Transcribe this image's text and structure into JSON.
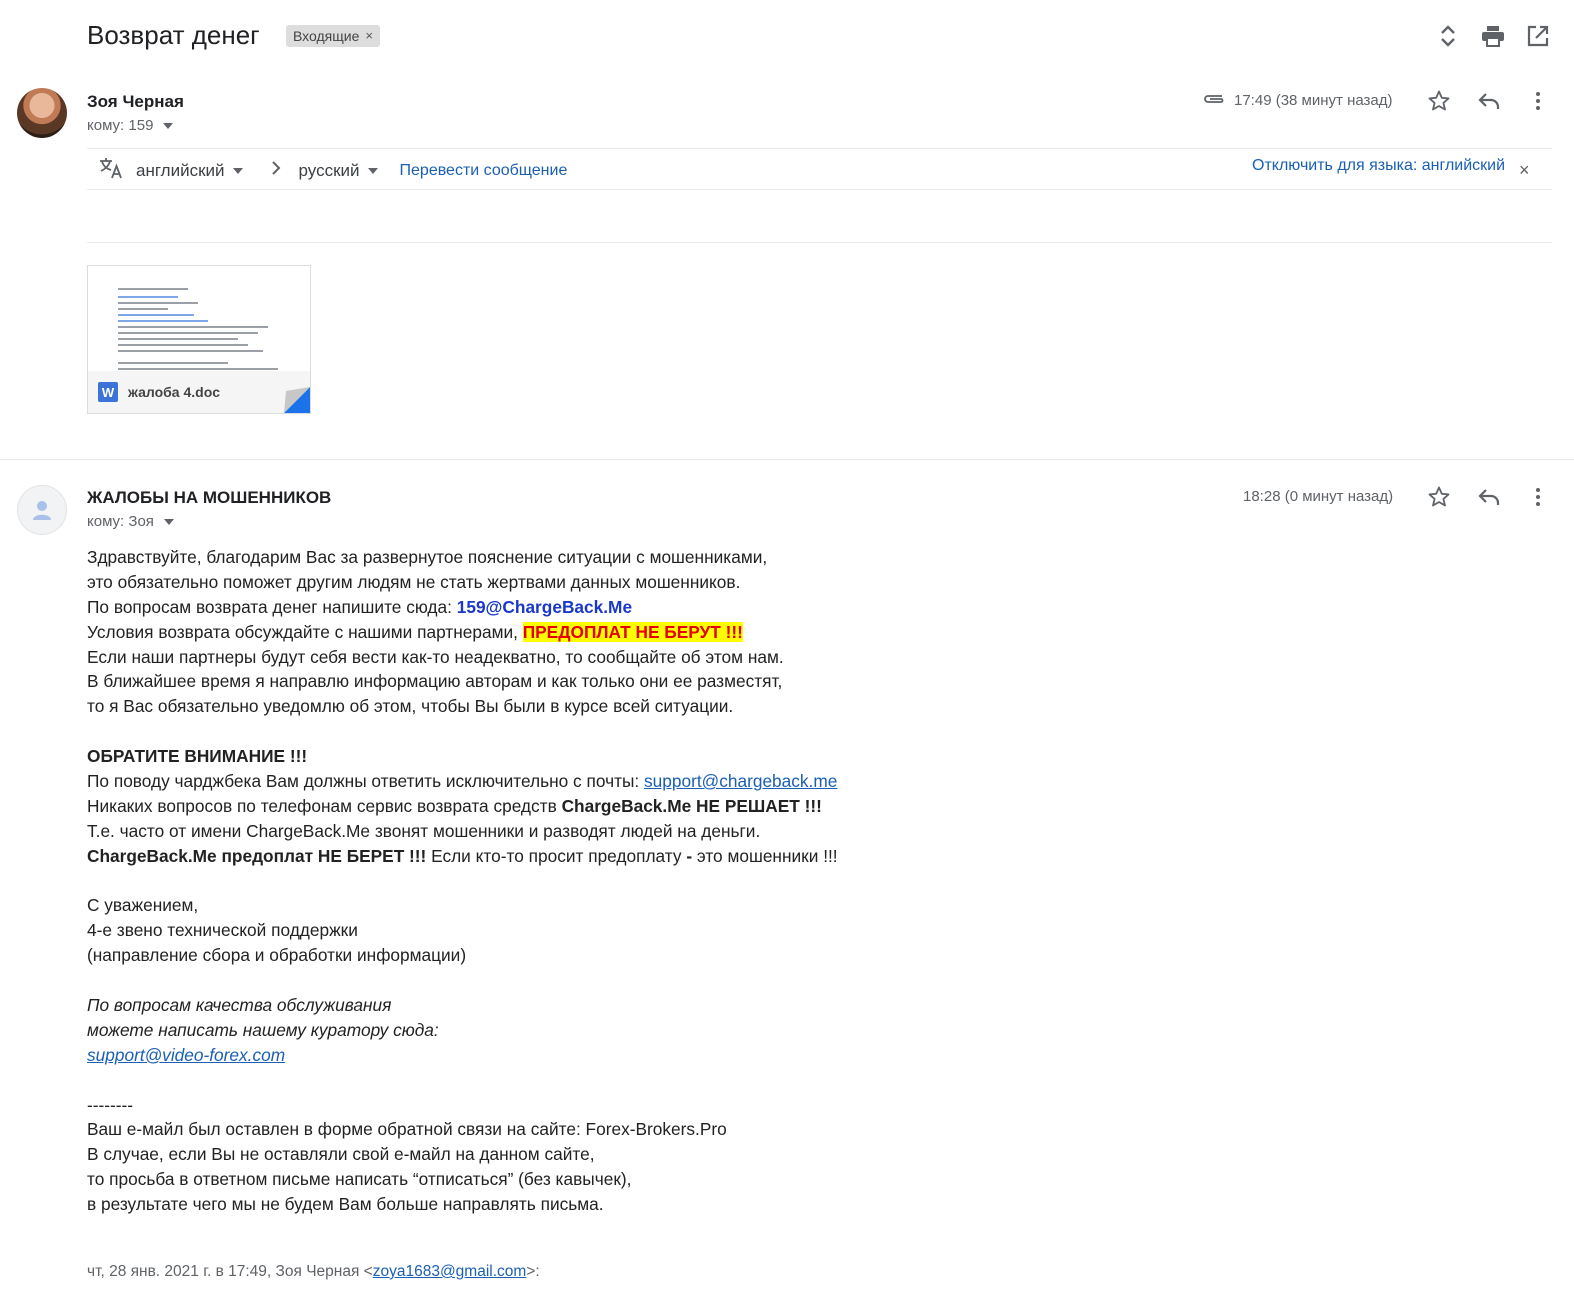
{
  "header": {
    "subject": "Возврат денег",
    "label": "Входящие",
    "label_close": "×"
  },
  "icons": {
    "expand": "unfold-icon",
    "print": "print-icon",
    "open_new": "open-in-new-icon",
    "attachment": "paperclip-icon",
    "star": "star-icon",
    "reply": "reply-icon",
    "more": "more-vertical-icon",
    "translate": "translate-icon"
  },
  "message1": {
    "sender": "Зоя Черная",
    "to": "кому: 159",
    "time": "17:49 (38 минут назад)"
  },
  "translate": {
    "from_lang": "английский",
    "to_lang": "русский",
    "translate_link": "Перевести сообщение",
    "disable_link": "Отключить для языка: английский",
    "disable_close": "×"
  },
  "attachment": {
    "badge": "W",
    "filename": "жалоба 4.doc"
  },
  "message2": {
    "sender": "ЖАЛОБЫ НА МОШЕННИКОВ",
    "to": "кому: Зоя",
    "time": "18:28 (0 минут назад)",
    "body": {
      "l1": "Здравствуйте, благодарим Вас за развернутое пояснение ситуации с мошенниками,",
      "l2": "это обязательно поможет другим людям не стать жертвами данных мошенников.",
      "l3_text": "По вопросам возврата денег напишите сюда: ",
      "l3_email": "159@ChargeBack.Me",
      "l4_text": "Условия возврата обсуждайте с нашими партнерами, ",
      "l4_highlight": "ПРЕДОПЛАТ НЕ БЕРУТ !!!",
      "l5": "Если наши партнеры будут себя вести как-то неадекватно, то сообщайте об этом нам.",
      "l6": "В ближайшее время я направлю информацию авторам и как только они ее разместят,",
      "l7": "то я Вас обязательно уведомлю об этом, чтобы Вы были в курсе всей ситуации.",
      "attention": "ОБРАТИТЕ ВНИМАНИЕ !!!",
      "l8_text": "По поводу чарджбека Вам должны ответить исключительно с почты: ",
      "l8_email": "support@chargeback.me",
      "l9_text": "Никаких вопросов по телефонам сервис возврата средств ",
      "l9_bold": "ChargeBack.Me НЕ РЕШАЕТ !!!",
      "l10": "Т.е. часто от имени ChargeBack.Me звонят мошенники и разводят людей на деньги.",
      "l11_bold": "ChargeBack.Me предоплат НЕ БЕРЕТ !!!",
      "l11_text": " Если кто-то просит предоплату ",
      "l11_dash": "-",
      "l11_tail": " это мошенники !!!",
      "sig1": "С уважением,",
      "sig2": "4-е звено технической поддержки",
      "sig3": "(направление сбора и обработки информации)",
      "q1": "По вопросам качества обслуживания",
      "q2": "можете написать нашему куратору сюда:",
      "q3": "support@video-forex.com",
      "sep": "--------",
      "f1": "Ваш е-майл был оставлен в форме обратной связи на сайте: Forex-Brokers.Pro",
      "f2": "В случае, если Вы не оставляли свой е-майл на данном сайте,",
      "f3": "то просьба в ответном письме написать “отписаться” (без кавычек),",
      "f4": "в результате чего мы не будем Вам больше направлять письма."
    },
    "quote_prefix": "чт, 28 янв. 2021 г. в 17:49, Зоя Черная <",
    "quote_email": "zoya1683@gmail.com",
    "quote_suffix": ">:"
  }
}
